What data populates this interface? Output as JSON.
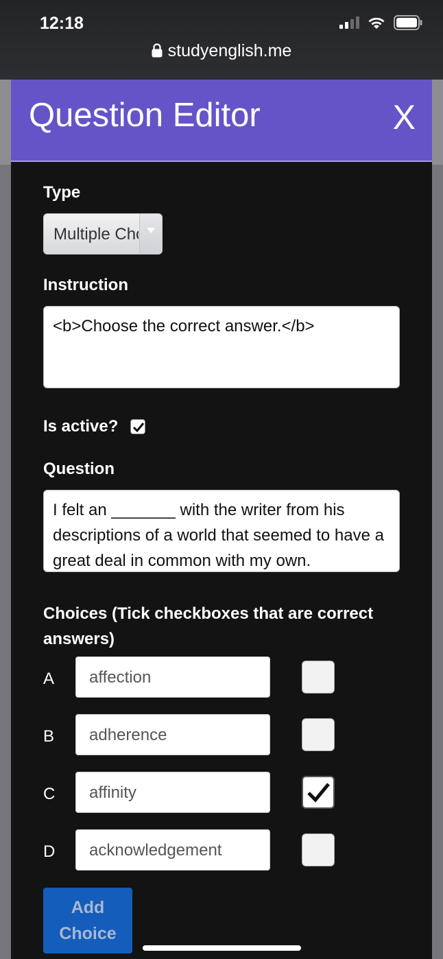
{
  "status_bar": {
    "time": "12:18",
    "url": "studyenglish.me"
  },
  "modal": {
    "title": "Question Editor",
    "close_label": "X",
    "type_label": "Type",
    "type_value": "Multiple Choice",
    "instruction_label": "Instruction",
    "instruction_value": "<b>Choose the correct answer.</b>",
    "is_active_label": "Is active?",
    "is_active": true,
    "question_label": "Question",
    "question_value": "I felt an _______ with the writer from his descriptions of a world that seemed to have a great deal in common with my own.",
    "choices_label": "Choices (Tick checkboxes that are correct answers)",
    "choices": [
      {
        "letter": "A",
        "value": "affection",
        "correct": false
      },
      {
        "letter": "B",
        "value": "adherence",
        "correct": false
      },
      {
        "letter": "C",
        "value": "affinity",
        "correct": true
      },
      {
        "letter": "D",
        "value": "acknowledgement",
        "correct": false
      }
    ],
    "add_choice_label": "Add Choice"
  },
  "colors": {
    "header": "#6554c8",
    "modal_bg": "#131313",
    "button": "#145dba"
  }
}
